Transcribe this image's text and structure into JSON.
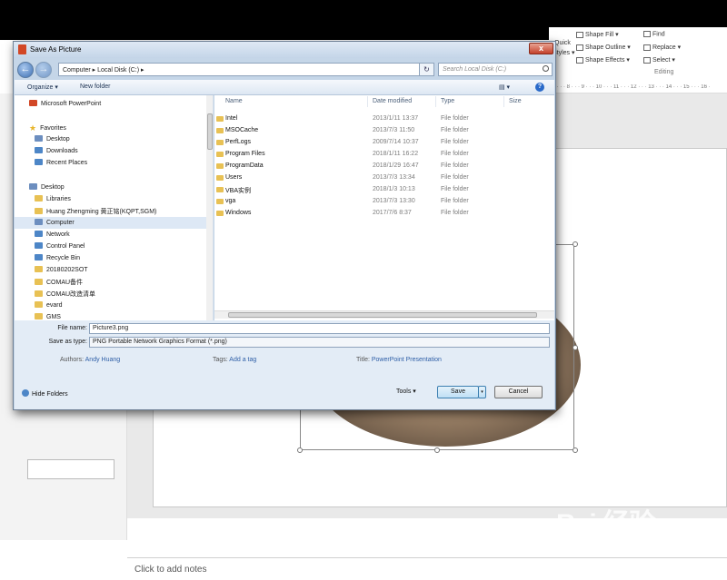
{
  "dialog": {
    "title": "Save As Picture",
    "close_label": "x",
    "back_label": "←",
    "forward_label": "→",
    "address_path": "Computer  ▸  Local Disk (C:)  ▸",
    "address_drop": "▾",
    "refresh_label": "↻",
    "search_placeholder": "Search Local Disk (C:)",
    "toolbar": {
      "organize": "Organize ▾",
      "new_folder": "New folder",
      "view": "▤ ▾",
      "help": "?"
    }
  },
  "nav": {
    "items": [
      {
        "label": "Microsoft PowerPoint",
        "icon": "ppt-icon"
      },
      {
        "label": "Favorites",
        "icon": "star-icon"
      },
      {
        "label": "Desktop",
        "icon": "desktop-icon"
      },
      {
        "label": "Downloads",
        "icon": "downloads-icon"
      },
      {
        "label": "Recent Places",
        "icon": "recent-places-icon"
      },
      {
        "label": "Desktop",
        "icon": "desktop-icon"
      },
      {
        "label": "Libraries",
        "icon": "libraries-icon"
      },
      {
        "label": "Huang Zhengming 黄正铭(KQPT,SGM)",
        "icon": "user-folder-icon"
      },
      {
        "label": "Computer",
        "icon": "computer-icon"
      },
      {
        "label": "Network",
        "icon": "network-icon"
      },
      {
        "label": "Control Panel",
        "icon": "control-panel-icon"
      },
      {
        "label": "Recycle Bin",
        "icon": "recycle-bin-icon"
      },
      {
        "label": "20180202SOT",
        "icon": "folder-icon"
      },
      {
        "label": "COMAU备件",
        "icon": "folder-icon"
      },
      {
        "label": "COMAU改造清单",
        "icon": "folder-icon"
      },
      {
        "label": "evard",
        "icon": "folder-icon"
      },
      {
        "label": "GMS",
        "icon": "folder-icon"
      }
    ]
  },
  "columns": {
    "name": "Name",
    "date": "Date modified",
    "type": "Type",
    "size": "Size"
  },
  "files": [
    {
      "name": "Intel",
      "date": "2013/1/11 13:37",
      "type": "File folder"
    },
    {
      "name": "MSOCache",
      "date": "2013/7/3 11:50",
      "type": "File folder"
    },
    {
      "name": "PerfLogs",
      "date": "2009/7/14 10:37",
      "type": "File folder"
    },
    {
      "name": "Program Files",
      "date": "2018/1/11 16:22",
      "type": "File folder"
    },
    {
      "name": "ProgramData",
      "date": "2018/1/29 16:47",
      "type": "File folder"
    },
    {
      "name": "Users",
      "date": "2013/7/3 13:34",
      "type": "File folder"
    },
    {
      "name": "VBA实例",
      "date": "2018/1/3 10:13",
      "type": "File folder"
    },
    {
      "name": "vga",
      "date": "2013/7/3 13:30",
      "type": "File folder"
    },
    {
      "name": "Windows",
      "date": "2017/7/6 8:37",
      "type": "File folder"
    }
  ],
  "form": {
    "filename_label": "File name:",
    "filename_value": "Picture3.png",
    "savetype_label": "Save as type:",
    "savetype_value": "PNG Portable Network Graphics Format (*.png)",
    "authors_label": "Authors:",
    "authors_value": "Andy Huang",
    "tags_label": "Tags:",
    "tags_value": "Add a tag",
    "title_label": "Title:",
    "title_value": "PowerPoint Presentation"
  },
  "footer": {
    "hide_folders": "Hide Folders",
    "tools": "Tools  ▾",
    "save": "Save",
    "cancel": "Cancel"
  },
  "ribbon": {
    "shape_fill": "Shape Fill ▾",
    "shape_outline": "Shape Outline ▾",
    "shape_effects": "Shape Effects ▾",
    "find": "Find",
    "replace": "Replace ▾",
    "select": "Select ▾",
    "editing": "Editing",
    "quick": "Quick",
    "styles": "Styles ▾",
    "window_controls": "?   ▭   −   ▢"
  },
  "ruler": {
    "h_text": "· 7 · · · 8 · · · 9 · · · 10 · · · 11 · · · 12 · · · 13 · · · 14 · · · 15 · · · 16 ·",
    "v_text": "4 · · · 5 · · · 6 · · · 7 · · · 8 · · · 9"
  },
  "notes": {
    "placeholder": "Click to add notes"
  },
  "watermark": {
    "brand": "Bai 经验",
    "url": "jingyan.baidu.com"
  }
}
